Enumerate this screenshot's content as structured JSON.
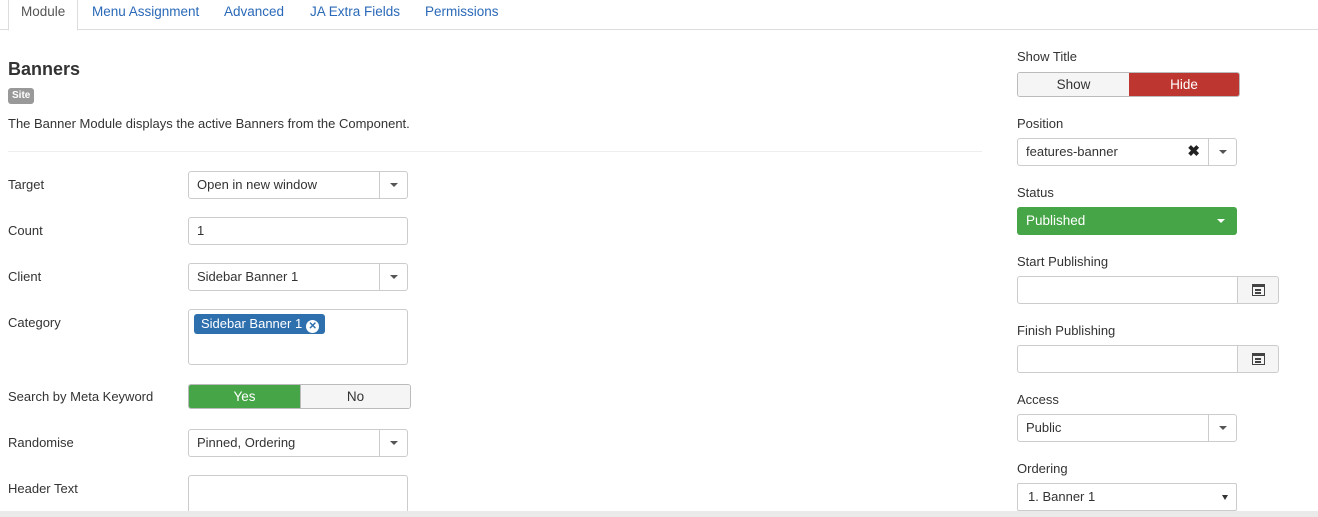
{
  "tabs": [
    {
      "label": "Module",
      "active": true
    },
    {
      "label": "Menu Assignment"
    },
    {
      "label": "Advanced"
    },
    {
      "label": "JA Extra Fields"
    },
    {
      "label": "Permissions"
    }
  ],
  "module": {
    "title": "Banners",
    "badge": "Site",
    "description": "The Banner Module displays the active Banners from the Component."
  },
  "fields": {
    "target": {
      "label": "Target",
      "value": "Open in new window"
    },
    "count": {
      "label": "Count",
      "value": "1"
    },
    "client": {
      "label": "Client",
      "value": "Sidebar Banner 1"
    },
    "category": {
      "label": "Category",
      "chip": "Sidebar Banner 1"
    },
    "meta_keyword": {
      "label": "Search by Meta Keyword",
      "yes": "Yes",
      "no": "No",
      "selected": "Yes"
    },
    "randomise": {
      "label": "Randomise",
      "value": "Pinned, Ordering"
    },
    "header_text": {
      "label": "Header Text",
      "value": ""
    }
  },
  "sidebar": {
    "show_title": {
      "label": "Show Title",
      "show": "Show",
      "hide": "Hide",
      "selected": "Hide"
    },
    "position": {
      "label": "Position",
      "value": "features-banner"
    },
    "status": {
      "label": "Status",
      "value": "Published"
    },
    "start_publishing": {
      "label": "Start Publishing",
      "value": ""
    },
    "finish_publishing": {
      "label": "Finish Publishing",
      "value": ""
    },
    "access": {
      "label": "Access",
      "value": "Public"
    },
    "ordering": {
      "label": "Ordering",
      "value": "1. Banner 1"
    }
  },
  "colors": {
    "accent_link": "#2a69b8",
    "success": "#46a546",
    "danger": "#bd362f",
    "chip": "#2e6fae"
  }
}
